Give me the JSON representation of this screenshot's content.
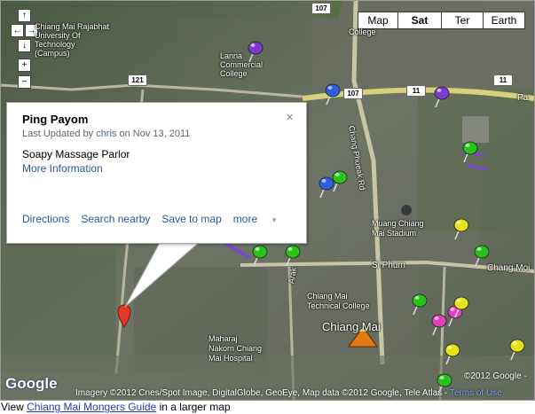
{
  "map_types": [
    "Map",
    "Sat",
    "Ter",
    "Earth"
  ],
  "selected_map_type": "Sat",
  "nav": {
    "up": "↑",
    "left": "←",
    "right": "→",
    "down": "↓",
    "zoom_in": "+",
    "zoom_out": "−"
  },
  "info": {
    "title": "Ping Payom",
    "updated_prefix": "Last Updated by",
    "author": "chris",
    "date": "on Nov 13, 2011",
    "description": "Soapy Massage Parlor",
    "more_info": "More Information",
    "actions": [
      "Directions",
      "Search nearby",
      "Save to map",
      "more"
    ],
    "close": "×"
  },
  "map_labels": {
    "college_top": "College",
    "lanna_commercial": "Lanna\nCommercial\nCollege",
    "chang_phueak_rd": "Chang Phueak Rd",
    "muang_stadium": "Muang Chiang\nMai Stadium",
    "si_phum": "Si Phum",
    "chang_moi": "Chang Moi",
    "chiang_mai_tech": "Chiang Mai\nTechnical College",
    "chiang_mai": "Chiang Mai",
    "maharaj": "Maharaj\nNakorn Chiang\nMai Hospital",
    "arak": "Arak",
    "pa": "Pa",
    "top_left": "Chiang Mai Rajabhat\nUniversity Of\nTechnology\n(Campus)"
  },
  "road_shields": [
    "107",
    "107",
    "11",
    "121",
    "11"
  ],
  "google_logo": "Google",
  "imagery_credit": "Imagery ©2012 Cnes/Spot Image, DigitalGlobe, GeoEye, Map data ©2012 Google, Tele Atlas -",
  "terms": "Terms of Use",
  "copyright": "©2012 Google -",
  "footer": {
    "prefix": "View",
    "link": "Chiang Mai Mongers Guide",
    "suffix": "in a larger map"
  },
  "colors": {
    "link": "#2b55a3",
    "pin_green": "#27c21a",
    "pin_purple": "#7a3ad0",
    "pin_blue": "#2f5fe0",
    "pin_yellow": "#e6e21a",
    "pin_pink": "#e040b8",
    "pin_red": "#e23a2a"
  }
}
